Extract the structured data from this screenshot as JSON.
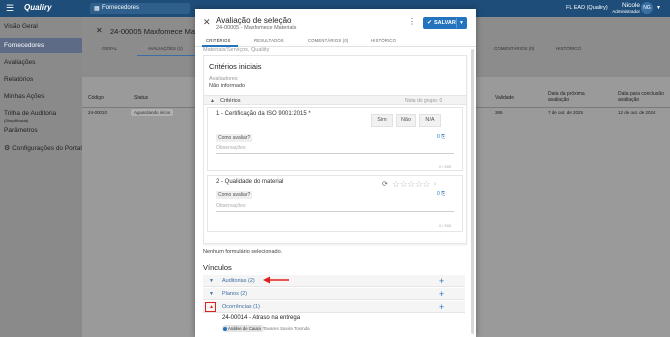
{
  "topbar": {
    "menu_icon": "hamburger-icon",
    "logo": "Qualiry",
    "module": "Fornecedores",
    "tenant": "FL EAD (Qualiry)",
    "user_name": "Nicole",
    "user_role": "Administrador",
    "avatar_initials": "NG"
  },
  "sidebar": {
    "items": [
      {
        "label": "Visão Geral"
      },
      {
        "label": "Fornecedores"
      },
      {
        "label": "Avaliações"
      },
      {
        "label": "Relatórios"
      },
      {
        "label": "Minhas Ações"
      },
      {
        "label": "Trilha de Auditoria",
        "tag": "(Simplificada)"
      },
      {
        "label": "Parâmetros"
      },
      {
        "label": "Configurações do Portal"
      }
    ]
  },
  "background": {
    "title": "24-00005 Maxfomece Materiais",
    "tabs": [
      "GERAL",
      "AVALIAÇÕES (1)",
      "COMENTÁRIOS (0)",
      "HISTÓRICO"
    ],
    "columns": [
      "Código",
      "Status",
      "Validade",
      "Data da próxima avaliação",
      "Data para conclusão avaliação"
    ],
    "row": {
      "codigo": "24-00010",
      "status": "Aguardando início",
      "validade": "365",
      "proxima": "7 de out. de 2025",
      "conclusao": "12 de out. de 2024"
    }
  },
  "modal": {
    "title": "Avaliação de seleção",
    "subtitle": "24-00005 - Maxfomece Materials",
    "save_label": "SALVAR",
    "tabs": [
      "CRITÉRIOS",
      "RESULTADOS",
      "COMENTÁRIOS (0)",
      "HISTÓRICO"
    ],
    "breadcrumb": "Materiais/Serviços, Qualiity",
    "card_title": "Critérios iniciais",
    "avaliadores_label": "Avaliadores",
    "avaliadores_value": "Não informado",
    "criteria_header": "Critérios",
    "group_grade": "Nota do grupo: 0",
    "questions": [
      {
        "title": "1 - Certificação da ISO 9001:2015 *",
        "options": [
          "Sim",
          "Não",
          "N/A"
        ],
        "how_label": "Como avaliar?",
        "link": "0",
        "obs_placeholder": "Observações",
        "count": "0 / 500"
      },
      {
        "title": "2 - Qualidade do material",
        "rating_max": 5,
        "rating_value": "0",
        "how_label": "Como avaliar?",
        "link": "0",
        "obs_placeholder": "Observações",
        "count": "0 / 500"
      }
    ],
    "no_form": "Nenhum formulário selecionado.",
    "vinculos_title": "Vínculos",
    "vinculos": [
      {
        "label": "Auditorias (2)"
      },
      {
        "label": "Planos (2)"
      },
      {
        "label": "Ocorrências (1)"
      }
    ],
    "occurrence": {
      "title": "24-00014 - Atraso na entrega",
      "chip": "Análise de Causa",
      "person": "Tavares Savira Tosmda"
    }
  },
  "colors": {
    "topbar": "#1e4d7a",
    "primary": "#2473bf",
    "highlight": "#e02020"
  }
}
